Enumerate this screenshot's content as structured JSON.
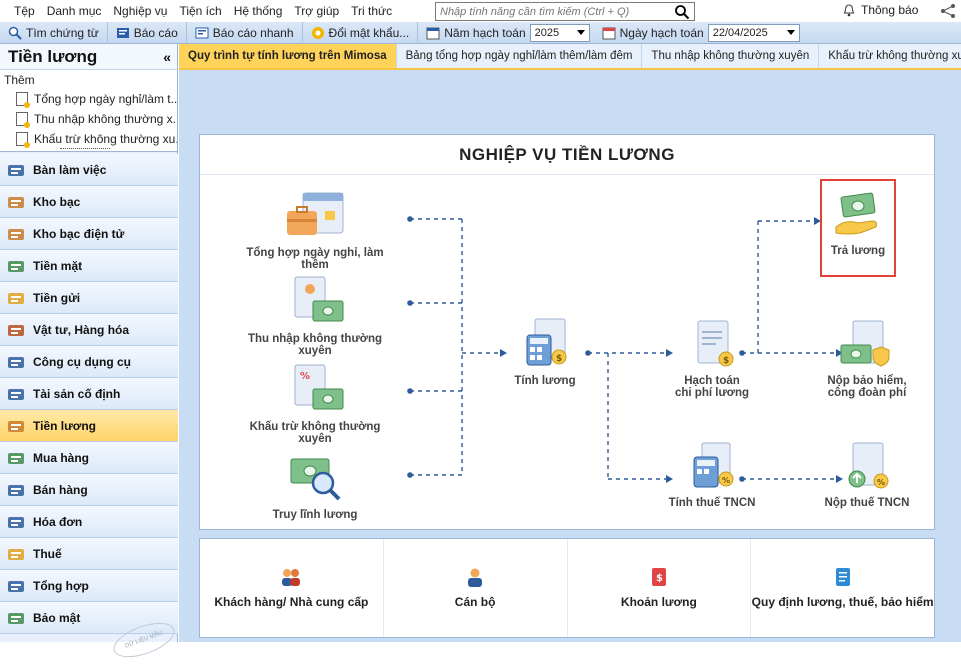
{
  "menu": [
    "Tệp",
    "Danh mục",
    "Nghiệp vụ",
    "Tiện ích",
    "Hệ thống",
    "Trợ giúp",
    "Tri thức"
  ],
  "search": {
    "placeholder": "Nhập tính năng cần tìm kiếm (Ctrl + Q)"
  },
  "notification": {
    "label": "Thông báo"
  },
  "toolbar": {
    "find_voucher": "Tìm chứng từ",
    "report": "Báo cáo",
    "quick_report": "Báo cáo nhanh",
    "change_password": "Đổi mật khẩu...",
    "fiscal_year_label": "Năm hạch toán",
    "fiscal_year_value": "2025",
    "posting_date_label": "Ngày hạch toán",
    "posting_date_value": "22/04/2025"
  },
  "sidebar": {
    "title": "Tiền lương",
    "collapse": "«",
    "add_label": "Thêm",
    "quick_items": [
      "Tổng hợp ngày nghỉ/làm t...",
      "Thu nhập không thường x...",
      "Khấu trừ không thường xu..."
    ],
    "nav": [
      {
        "label": "Bàn làm việc",
        "icon": "desk-icon"
      },
      {
        "label": "Kho bạc",
        "icon": "treasury-icon"
      },
      {
        "label": "Kho bạc điện tử",
        "icon": "e-treasury-icon"
      },
      {
        "label": "Tiền mặt",
        "icon": "cash-icon"
      },
      {
        "label": "Tiền gửi",
        "icon": "deposit-icon"
      },
      {
        "label": "Vật tư, Hàng hóa",
        "icon": "inventory-icon"
      },
      {
        "label": "Công cụ dụng cụ",
        "icon": "tools-icon"
      },
      {
        "label": "Tài sản cố định",
        "icon": "fixed-asset-icon"
      },
      {
        "label": "Tiền lương",
        "icon": "salary-icon",
        "active": true
      },
      {
        "label": "Mua hàng",
        "icon": "cart-icon"
      },
      {
        "label": "Bán hàng",
        "icon": "sales-icon"
      },
      {
        "label": "Hóa đơn",
        "icon": "invoice-icon"
      },
      {
        "label": "Thuế",
        "icon": "tax-icon"
      },
      {
        "label": "Tổng hợp",
        "icon": "summary-icon"
      },
      {
        "label": "Bảo mật",
        "icon": "security-icon"
      }
    ]
  },
  "tabs": [
    {
      "label": "Quy trình tự tính lương trên Mimosa",
      "active": true
    },
    {
      "label": "Bảng tổng hợp ngày nghỉ/làm thêm/làm đêm"
    },
    {
      "label": "Thu nhập không thường xuyên"
    },
    {
      "label": "Khấu trừ không thường xuyên"
    }
  ],
  "process": {
    "title": "NGHIỆP VỤ TIỀN LƯƠNG",
    "nodes": {
      "leave_overtime": "Tổng hợp ngày nghỉ, làm thêm",
      "irregular_income": "Thu nhập không thường xuyên",
      "irregular_deduction": "Khấu trừ không thường xuyên",
      "salary_trace": "Truy lĩnh lương",
      "calc_salary": "Tính lương",
      "salary_expense_line1": "Hạch toán",
      "salary_expense_line2": "chi phí lương",
      "calc_pit": "Tính thuế TNCN",
      "pay_salary": "Trả lương",
      "insurance_line1": "Nộp bảo hiểm,",
      "insurance_line2": "công đoàn phí",
      "pay_pit": "Nộp thuế TNCN"
    }
  },
  "bottom": {
    "customers": "Khách hàng/ Nhà cung cấp",
    "staff": "Cán bộ",
    "salary_items": "Khoản lương",
    "regulations": "Quy định lương, thuế, bảo hiểm"
  },
  "colors": {
    "accent": "#ffd35a",
    "toolbar": "#c6d9f1",
    "content_bg": "#c8dcf4",
    "highlight": "#e0413a"
  }
}
